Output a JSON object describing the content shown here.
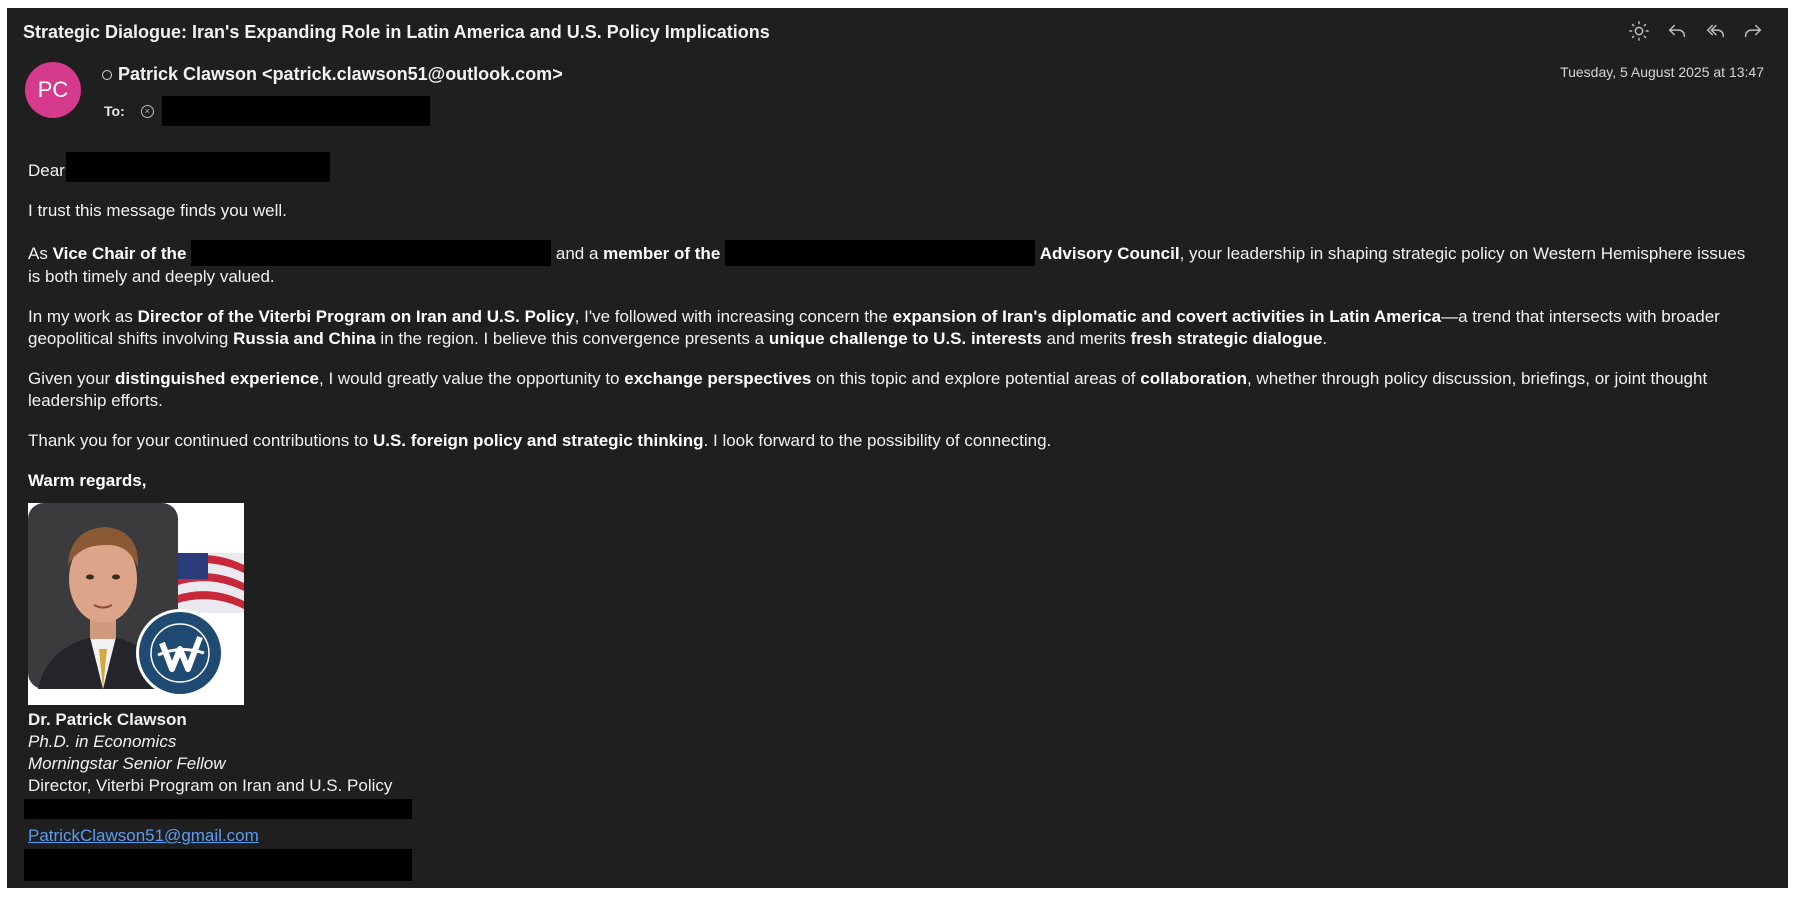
{
  "subject": "Strategic Dialogue: Iran's Expanding Role in Latin America and U.S. Policy Implications",
  "toolbar": {
    "icons": [
      "brightness-icon",
      "reply-icon",
      "reply-all-icon",
      "forward-icon"
    ]
  },
  "sender": {
    "initials": "PC",
    "avatar_color": "#d63a8c",
    "from": "Patrick Clawson <patrick.clawson51@outlook.com>",
    "to_label": "To:",
    "date": "Tuesday, 5 August 2025 at 13:47"
  },
  "body": {
    "greeting": "Dear",
    "p1": "I trust this message finds you well.",
    "p2": {
      "t1": "As ",
      "b1": "Vice Chair of the",
      "t2": " and a ",
      "b2": "member of the",
      "b3": "Advisory Council",
      "t3": ", your leadership in shaping strategic policy on Western Hemisphere issues is both timely and deeply valued."
    },
    "p3": {
      "t1": "In my work as ",
      "b1": "Director of the Viterbi Program on Iran and U.S. Policy",
      "t2": ", I've followed with increasing concern the ",
      "b2": "expansion of Iran's diplomatic and covert activities in Latin America",
      "t3": "—a trend that intersects with broader geopolitical shifts involving ",
      "b3": "Russia and China",
      "t4": " in the region. I believe this convergence presents a ",
      "b4": "unique challenge to U.S. interests",
      "t5": " and merits ",
      "b5": "fresh strategic dialogue",
      "t6": "."
    },
    "p4": {
      "t1": "Given your ",
      "b1": "distinguished experience",
      "t2": ", I would greatly value the opportunity to ",
      "b2": "exchange perspectives",
      "t3": " on this topic and explore potential areas of ",
      "b3": "collaboration",
      "t4": ", whether through policy discussion, briefings, or joint thought leadership efforts."
    },
    "p5": {
      "t1": "Thank you for your continued contributions to ",
      "b1": "U.S. foreign policy and strategic thinking",
      "t2": ". I look forward to the possibility of connecting."
    },
    "closing": "Warm regards,"
  },
  "signature": {
    "name": "Dr. Patrick Clawson",
    "degree": "Ph.D. in Economics",
    "fellow": "Morningstar Senior Fellow",
    "title": "Director, Viterbi Program on Iran and U.S. Policy",
    "email": "PatrickClawson51@gmail.com",
    "seal_text": "IDEAS · ACTION · IMPACT · THE WASHINGTON INSTITUTE FOR NEAR EAST POLICY"
  }
}
